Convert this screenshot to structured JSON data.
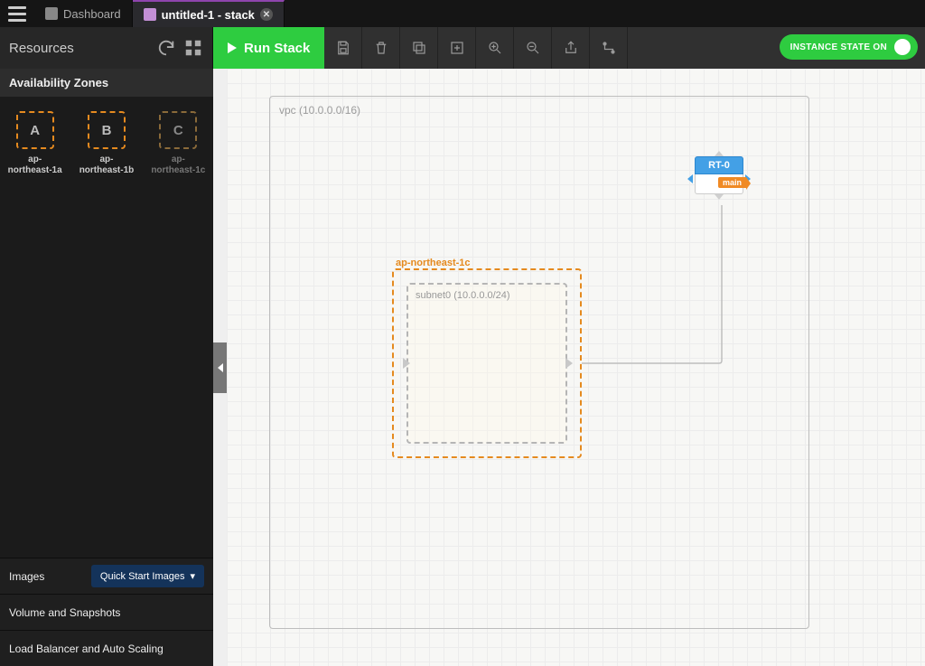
{
  "tabs": {
    "dashboard": "Dashboard",
    "active": "untitled-1 - stack"
  },
  "sidebar": {
    "title": "Resources",
    "section_az": "Availability Zones",
    "az": [
      {
        "letter": "A",
        "label": "ap-northeast-1a"
      },
      {
        "letter": "B",
        "label": "ap-northeast-1b"
      },
      {
        "letter": "C",
        "label": "ap-northeast-1c"
      }
    ],
    "images_label": "Images",
    "quick_start": "Quick Start Images",
    "volumes_label": "Volume and Snapshots",
    "lb_label": "Load Balancer and Auto Scaling"
  },
  "toolbar": {
    "run": "Run Stack",
    "instance_state": "INSTANCE STATE ON"
  },
  "canvas": {
    "vpc_label": "vpc (10.0.0.0/16)",
    "az_label": "ap-northeast-1c",
    "subnet_label": "subnet0 (10.0.0.0/24)",
    "rt_name": "RT-0",
    "rt_tag": "main"
  }
}
